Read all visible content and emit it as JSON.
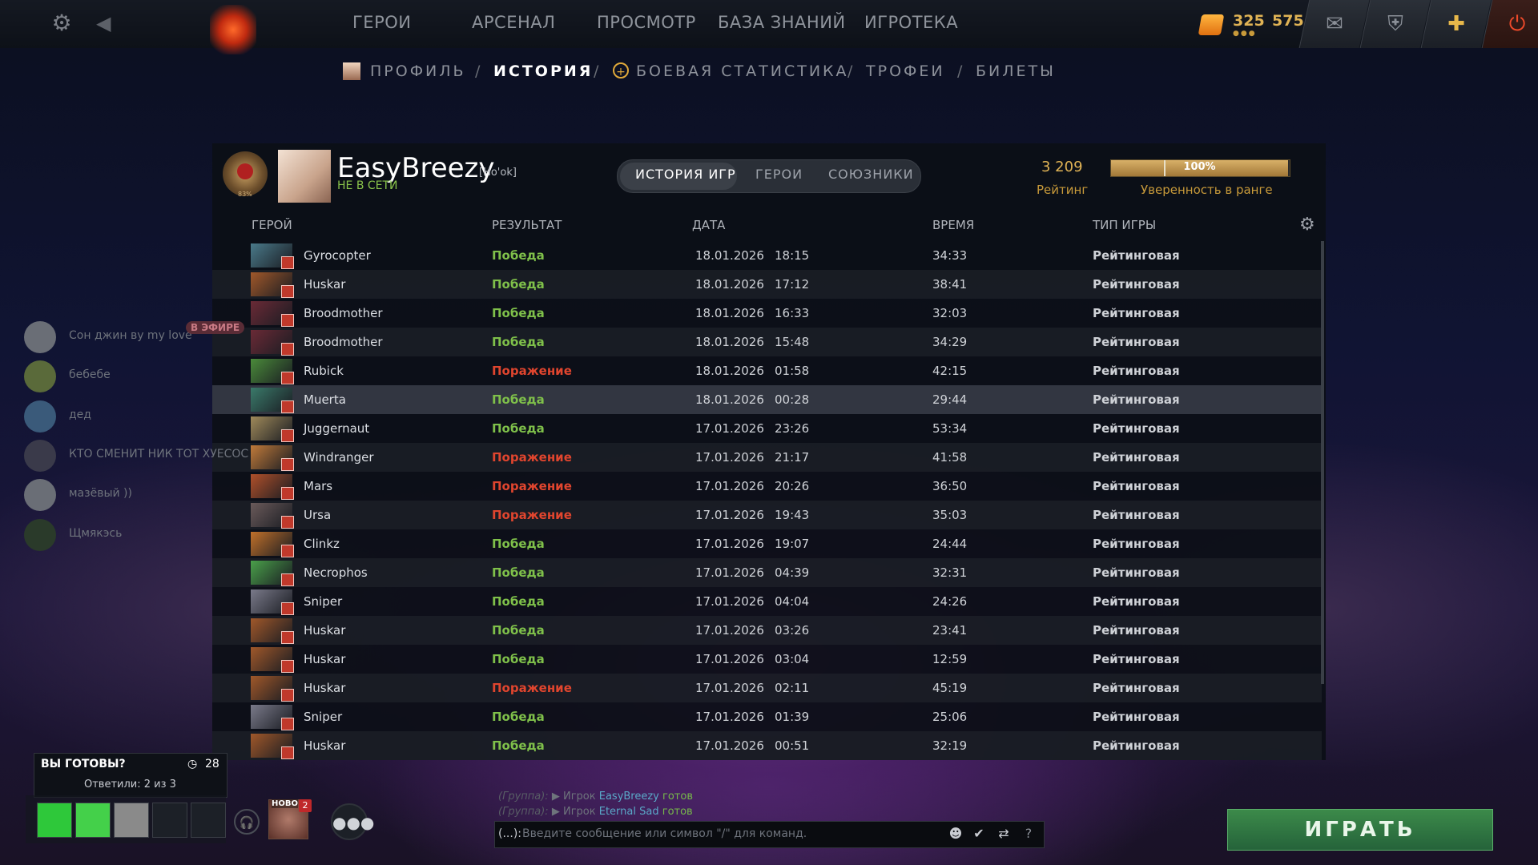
{
  "topbar": {
    "nav": [
      "ГЕРОИ",
      "АРСЕНАЛ",
      "ПРОСМОТР",
      "БАЗА ЗНАНИЙ",
      "ИГРОТЕКА"
    ],
    "shards": "325",
    "gold": "575"
  },
  "subnav": {
    "items": [
      "ПРОФИЛЬ",
      "ИСТОРИЯ",
      "БОЕВАЯ СТАТИСТИКА",
      "ТРОФЕИ",
      "БИЛЕТЫ"
    ],
    "separator": "/",
    "active": "ИСТОРИЯ"
  },
  "profile": {
    "name": "EasyBreezy",
    "tag": "[Ho'ok]",
    "status": "НЕ В СЕТИ",
    "rank_percent": "83%",
    "tabs": [
      "ИСТОРИЯ ИГР",
      "ГЕРОИ",
      "СОЮЗНИКИ"
    ],
    "rating_value": "3 209",
    "rating_label": "Рейтинг",
    "confidence_value": "100%",
    "confidence_fraction": 1.0,
    "confidence_label": "Уверенность в ранге"
  },
  "table": {
    "columns": [
      "ГЕРОЙ",
      "РЕЗУЛЬТАТ",
      "ДАТА",
      "ВРЕМЯ",
      "ТИП ИГРЫ"
    ],
    "rows": [
      {
        "hero": "Gyrocopter",
        "result": "Победа",
        "date": "18.01.2026",
        "time": "18:15",
        "duration": "34:33",
        "type": "Рейтинговая",
        "color": "#4a7a8a"
      },
      {
        "hero": "Huskar",
        "result": "Победа",
        "date": "18.01.2026",
        "time": "17:12",
        "duration": "38:41",
        "type": "Рейтинговая",
        "color": "#a0582a"
      },
      {
        "hero": "Broodmother",
        "result": "Победа",
        "date": "18.01.2026",
        "time": "16:33",
        "duration": "32:03",
        "type": "Рейтинговая",
        "color": "#6a2a36"
      },
      {
        "hero": "Broodmother",
        "result": "Победа",
        "date": "18.01.2026",
        "time": "15:48",
        "duration": "34:29",
        "type": "Рейтинговая",
        "color": "#6a2a36"
      },
      {
        "hero": "Rubick",
        "result": "Поражение",
        "date": "18.01.2026",
        "time": "01:58",
        "duration": "42:15",
        "type": "Рейтинговая",
        "color": "#4a8a3a"
      },
      {
        "hero": "Muerta",
        "result": "Победа",
        "date": "18.01.2026",
        "time": "00:28",
        "duration": "29:44",
        "type": "Рейтинговая",
        "color": "#3a7a6a"
      },
      {
        "hero": "Juggernaut",
        "result": "Победа",
        "date": "17.01.2026",
        "time": "23:26",
        "duration": "53:34",
        "type": "Рейтинговая",
        "color": "#a08a5a"
      },
      {
        "hero": "Windranger",
        "result": "Поражение",
        "date": "17.01.2026",
        "time": "21:17",
        "duration": "41:58",
        "type": "Рейтинговая",
        "color": "#c07a3a"
      },
      {
        "hero": "Mars",
        "result": "Поражение",
        "date": "17.01.2026",
        "time": "20:26",
        "duration": "36:50",
        "type": "Рейтинговая",
        "color": "#b0502a"
      },
      {
        "hero": "Ursa",
        "result": "Поражение",
        "date": "17.01.2026",
        "time": "19:43",
        "duration": "35:03",
        "type": "Рейтинговая",
        "color": "#6a5a5a"
      },
      {
        "hero": "Clinkz",
        "result": "Победа",
        "date": "17.01.2026",
        "time": "19:07",
        "duration": "24:44",
        "type": "Рейтинговая",
        "color": "#c0702a"
      },
      {
        "hero": "Necrophos",
        "result": "Победа",
        "date": "17.01.2026",
        "time": "04:39",
        "duration": "32:31",
        "type": "Рейтинговая",
        "color": "#4aa04a"
      },
      {
        "hero": "Sniper",
        "result": "Победа",
        "date": "17.01.2026",
        "time": "04:04",
        "duration": "24:26",
        "type": "Рейтинговая",
        "color": "#7a7a8a"
      },
      {
        "hero": "Huskar",
        "result": "Победа",
        "date": "17.01.2026",
        "time": "03:26",
        "duration": "23:41",
        "type": "Рейтинговая",
        "color": "#a0582a"
      },
      {
        "hero": "Huskar",
        "result": "Победа",
        "date": "17.01.2026",
        "time": "03:04",
        "duration": "12:59",
        "type": "Рейтинговая",
        "color": "#a0582a"
      },
      {
        "hero": "Huskar",
        "result": "Поражение",
        "date": "17.01.2026",
        "time": "02:11",
        "duration": "45:19",
        "type": "Рейтинговая",
        "color": "#a0582a"
      },
      {
        "hero": "Sniper",
        "result": "Победа",
        "date": "17.01.2026",
        "time": "01:39",
        "duration": "25:06",
        "type": "Рейтинговая",
        "color": "#7a7a8a"
      },
      {
        "hero": "Huskar",
        "result": "Победа",
        "date": "17.01.2026",
        "time": "00:51",
        "duration": "32:19",
        "type": "Рейтинговая",
        "color": "#a0582a"
      }
    ],
    "win_color": "#7fc04a",
    "loss_color": "#e0452e"
  },
  "friends": [
    {
      "name": "Сон джин ву my love"
    },
    {
      "name": "бебебе"
    },
    {
      "name": "дед"
    },
    {
      "name": "КТО СМЕНИТ НИК ТОТ ХУЕСОС"
    },
    {
      "name": "мазёвый ))"
    },
    {
      "name": "Щмякэсь"
    }
  ],
  "live_badge": "В ЭФИРЕ",
  "ready": {
    "title": "ВЫ ГОТОВЫ?",
    "timer": "28",
    "answered": "Ответили: 2 из 3"
  },
  "news": {
    "label": "НОВО",
    "badge": "2"
  },
  "chat": {
    "lines": [
      {
        "group": "(Группа):",
        "player_word": "Игрок",
        "name": "EasyBreezy",
        "status": "готов"
      },
      {
        "group": "(Группа):",
        "player_word": "Игрок",
        "name": "Eternal Sad",
        "status": "готов"
      }
    ],
    "prefix": "(...):",
    "placeholder": "Введите сообщение или символ \"/\" для команд."
  },
  "play_button": "ИГРАТЬ"
}
